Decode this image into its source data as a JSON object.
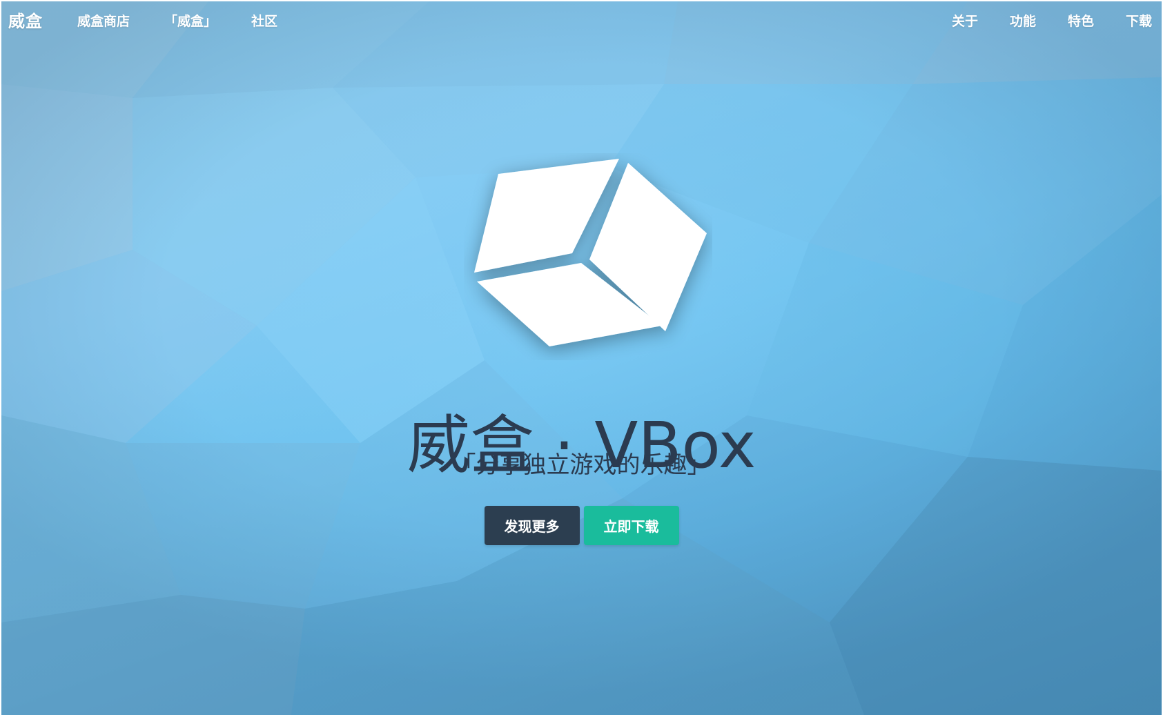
{
  "nav": {
    "brand": "威盒",
    "left_links": [
      "威盒商店",
      "「威盒」",
      "社区"
    ],
    "right_links": [
      "关于",
      "功能",
      "特色",
      "下载"
    ]
  },
  "hero": {
    "logo_icon": "white-cube-icon",
    "title": "威盒 · VBox",
    "subtitle": "「分享独立游戏的乐趣」",
    "primary_button": "发现更多",
    "secondary_button": "立即下载"
  },
  "colors": {
    "background_blue": "#6fc3ef",
    "title_text": "#2b3b50",
    "button_dark": "#2c3e50",
    "button_green": "#1abc9c",
    "nav_text": "#ffffff"
  }
}
